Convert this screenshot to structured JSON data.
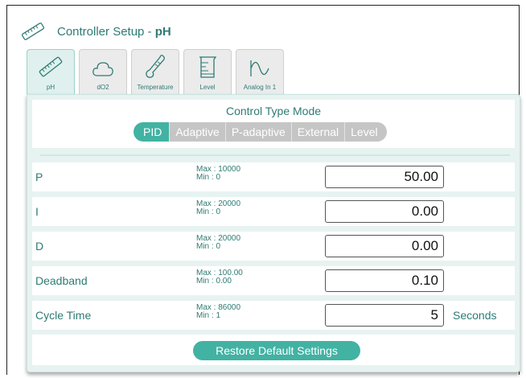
{
  "header": {
    "title_prefix": "Controller Setup - ",
    "title_bold": "pH",
    "icon": "ph-probe-icon"
  },
  "tabs": [
    {
      "label": "pH",
      "icon": "ph-probe-icon",
      "active": true
    },
    {
      "label": "dO2",
      "icon": "cloud-icon",
      "active": false
    },
    {
      "label": "Temperature",
      "icon": "thermometer-icon",
      "active": false
    },
    {
      "label": "Level",
      "icon": "beaker-icon",
      "active": false
    },
    {
      "label": "Analog In 1",
      "icon": "waveform-icon",
      "active": false
    }
  ],
  "control_mode": {
    "title": "Control Type Mode",
    "options": [
      "PID",
      "Adaptive",
      "P-adaptive",
      "External",
      "Level"
    ],
    "selected": "PID"
  },
  "params": [
    {
      "label": "P",
      "max": "Max  : 10000",
      "min": "Min   : 0",
      "value": "50.00",
      "unit": ""
    },
    {
      "label": "I",
      "max": "Max  : 20000",
      "min": "Min   : 0",
      "value": "0.00",
      "unit": ""
    },
    {
      "label": "D",
      "max": "Max  : 20000",
      "min": "Min   : 0",
      "value": "0.00",
      "unit": ""
    },
    {
      "label": "Deadband",
      "max": "Max  : 100.00",
      "min": "Min   : 0.00",
      "value": "0.10",
      "unit": ""
    },
    {
      "label": "Cycle Time",
      "max": "Max  : 86000",
      "min": "Min   : 1",
      "value": "5",
      "unit": "Seconds"
    }
  ],
  "restore_label": "Restore Default Settings",
  "colors": {
    "accent": "#42b2a3",
    "text": "#2e7b74",
    "panel_bg": "#e7f3f1",
    "inactive": "#c5c5c5"
  }
}
